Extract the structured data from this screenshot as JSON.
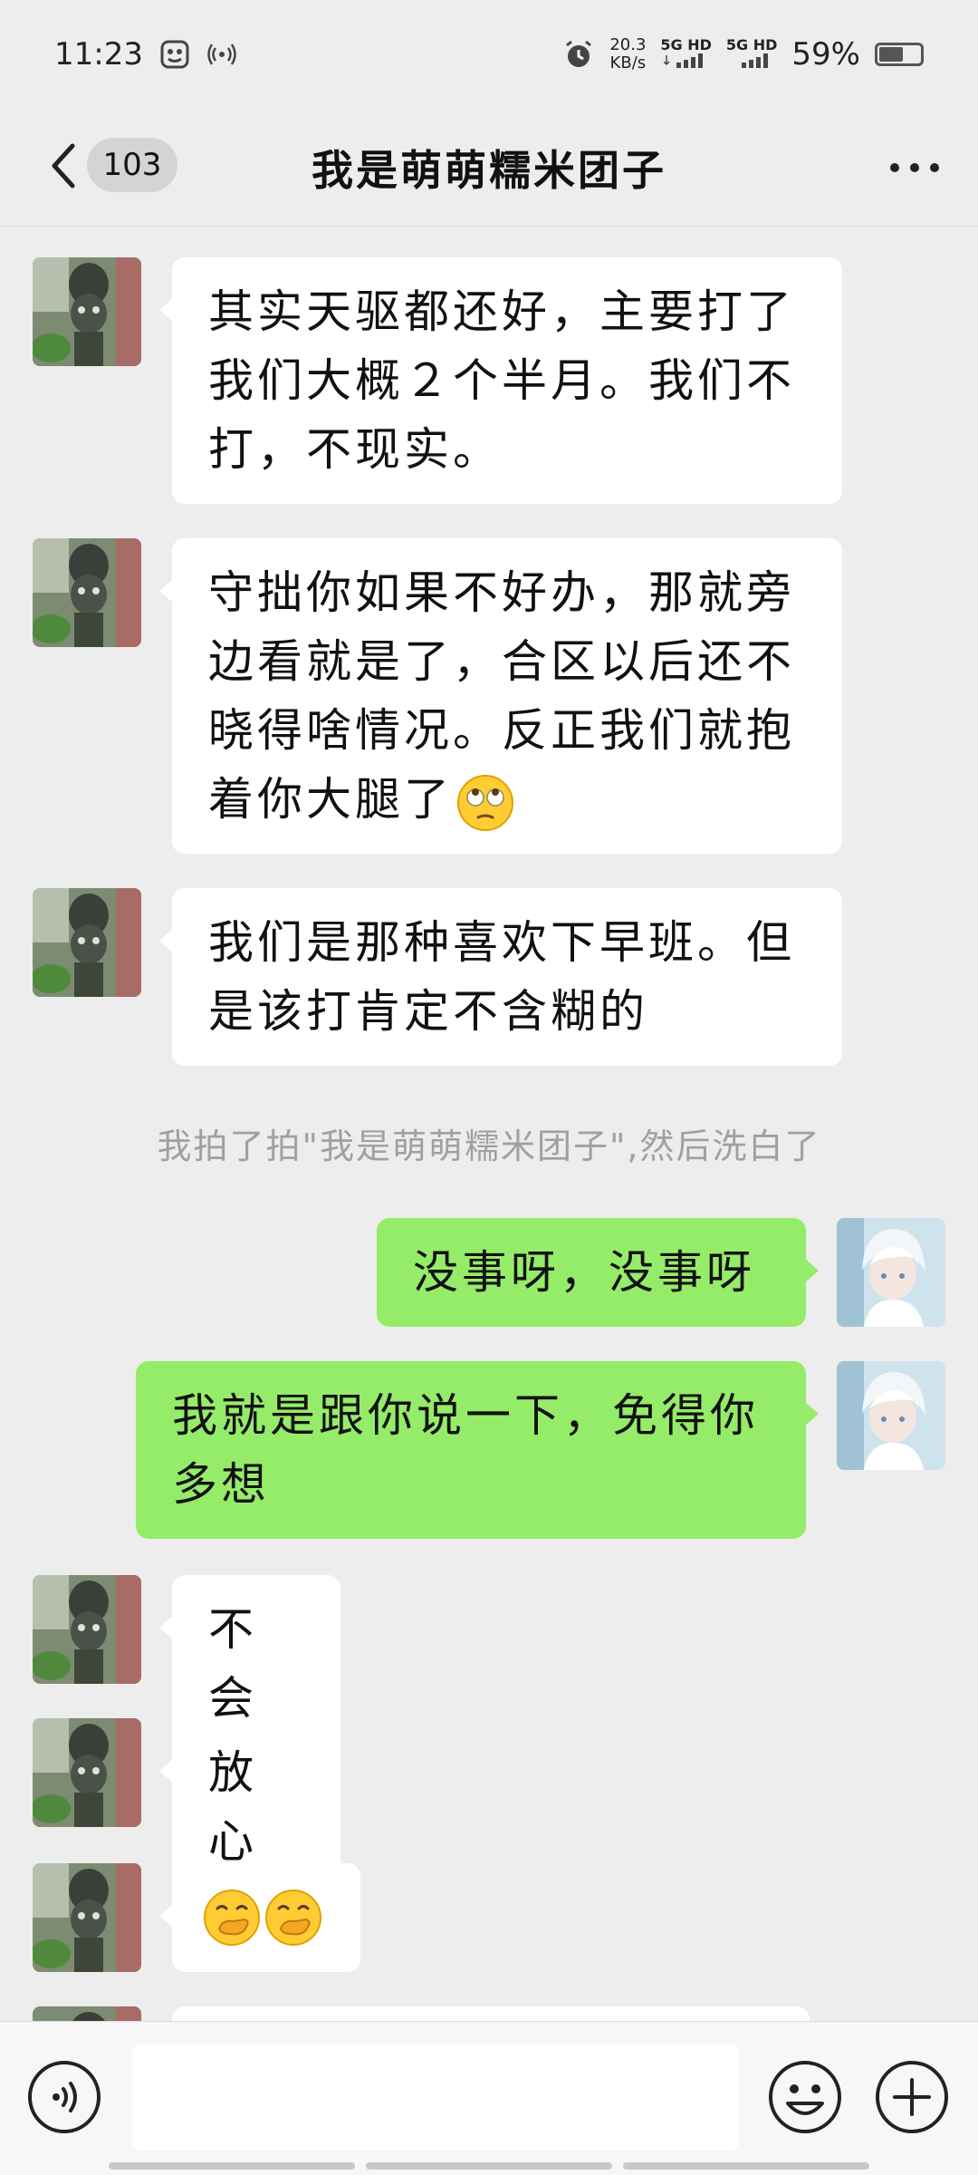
{
  "status_bar": {
    "time": "11:23",
    "net_speed": "20.3",
    "net_unit": "KB/s",
    "sim1": "5G HD",
    "sim2": "5G HD",
    "battery": "59%",
    "battery_level": 0.59
  },
  "header": {
    "unread_count": "103",
    "title": "我是萌萌糯米团子"
  },
  "messages": [
    {
      "side": "in",
      "lines": [
        "其实天驱都还好，主要打了",
        "我们大概２个半月。我们不",
        "打，不现实。"
      ]
    },
    {
      "side": "in",
      "lines": [
        "守拙你如果不好办，那就旁",
        "边看就是了，合区以后还不",
        "晓得啥情况。反正我们就抱",
        "着你大腿了"
      ],
      "emoji": "rolling-eyes-emoji"
    },
    {
      "side": "in",
      "lines": [
        "我们是那种喜欢下早班。但",
        "是该打肯定不含糊的"
      ]
    },
    {
      "side": "out",
      "lines": [
        "没事呀，没事呀"
      ]
    },
    {
      "side": "out",
      "lines": [
        "我就是跟你说一下，免得你",
        "多想"
      ]
    },
    {
      "side": "in",
      "lines": [
        "不会"
      ]
    },
    {
      "side": "in",
      "lines": [
        "放心"
      ]
    },
    {
      "side": "in",
      "emojis": [
        "hand-over-mouth-emoji",
        "hand-over-mouth-emoji"
      ]
    }
  ],
  "system_message": "我拍了拍\"我是萌萌糯米团子\",然后洗白了",
  "input": {
    "value": "",
    "placeholder": ""
  },
  "icons": {
    "back": "chevron-left-icon",
    "more": "more-icon",
    "voice": "voice-icon",
    "emoji": "emoji-icon",
    "plus": "plus-icon"
  },
  "colors": {
    "background": "#ededed",
    "incoming_bubble": "#ffffff",
    "outgoing_bubble": "#95ec69",
    "system_text": "#a0a0a0"
  }
}
